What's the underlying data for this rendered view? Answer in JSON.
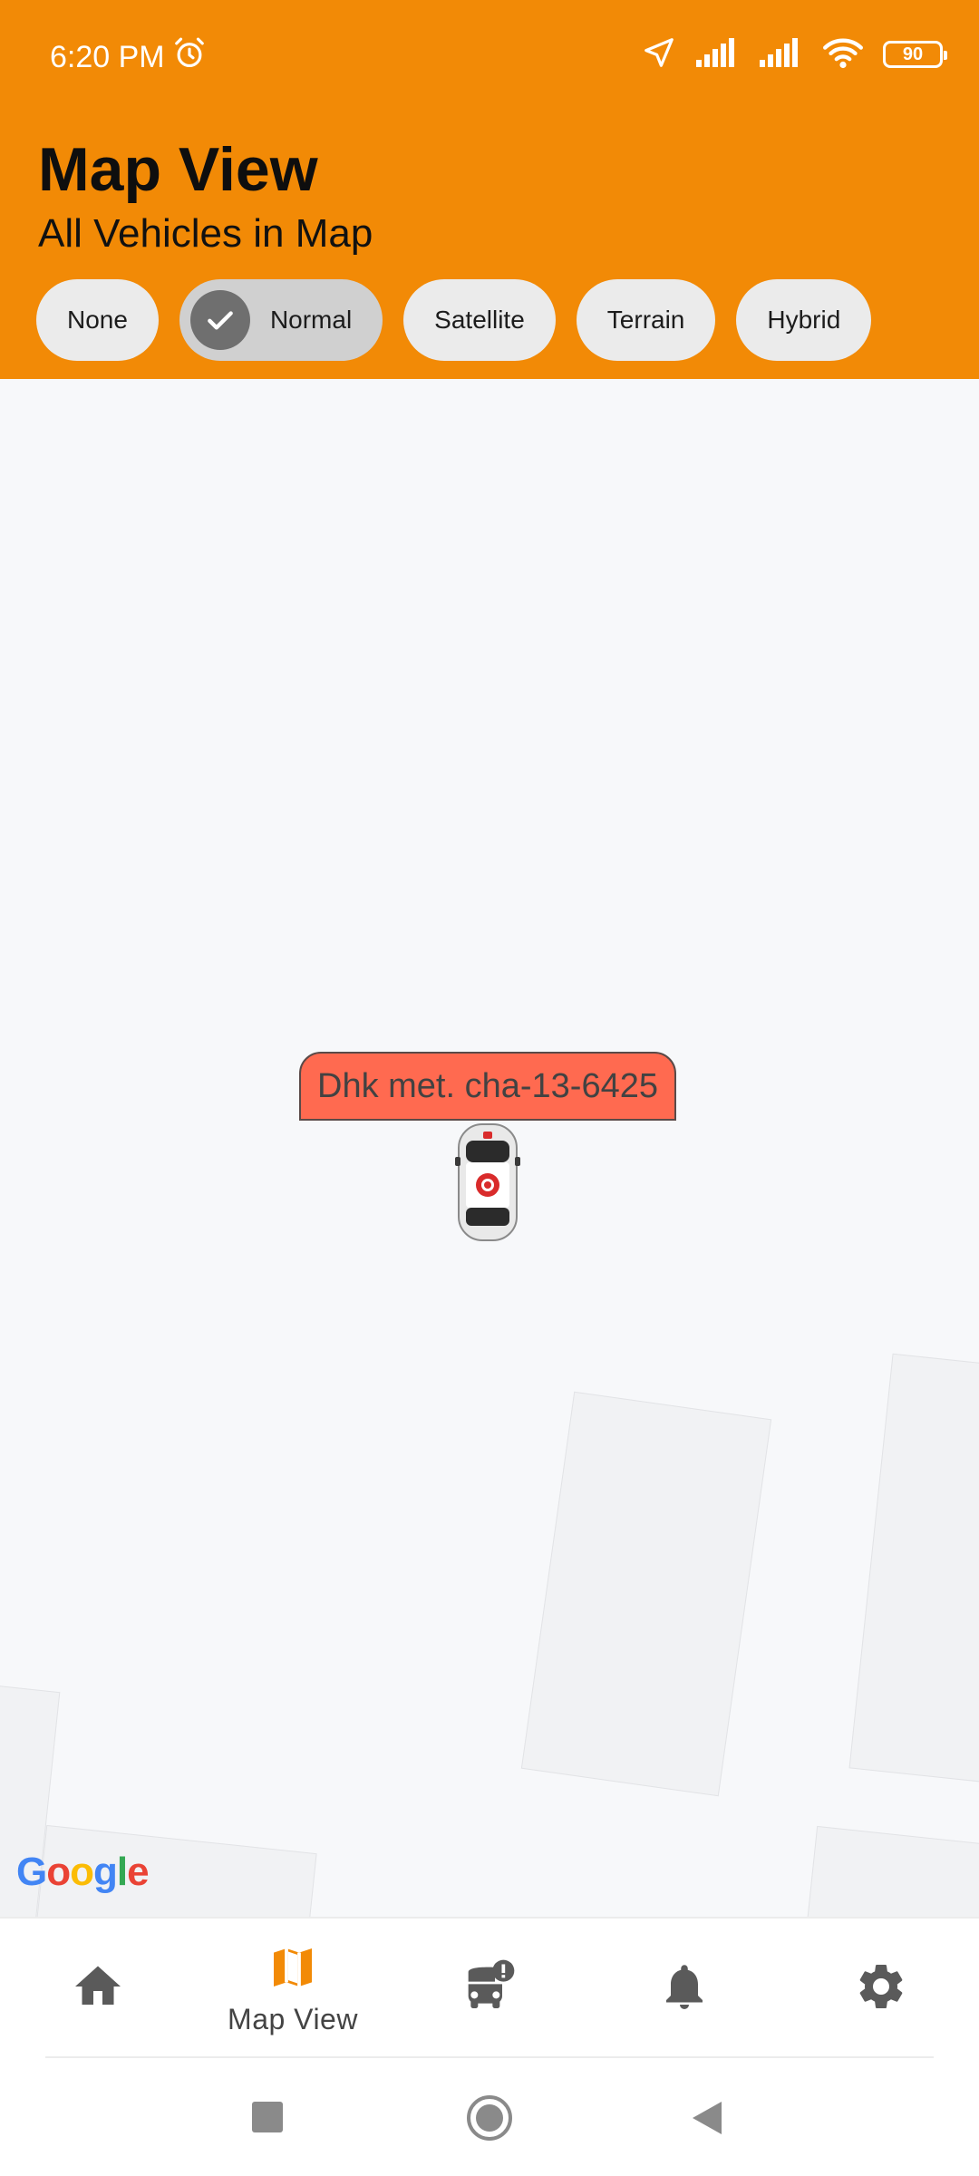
{
  "status_bar": {
    "time": "6:20 PM",
    "battery": "90",
    "icons": [
      "alarm-icon",
      "location-icon",
      "signal-icon",
      "signal-icon",
      "wifi-icon",
      "battery-icon"
    ]
  },
  "header": {
    "title": "Map View",
    "subtitle": "All Vehicles in Map",
    "background_color": "#f28a06"
  },
  "map_types": [
    {
      "label": "None",
      "selected": false
    },
    {
      "label": "Normal",
      "selected": true
    },
    {
      "label": "Satellite",
      "selected": false
    },
    {
      "label": "Terrain",
      "selected": false
    },
    {
      "label": "Hybrid",
      "selected": false
    }
  ],
  "map": {
    "vehicle_label": "Dhk met. cha-13-6425",
    "vehicle_label_color": "#ff6a50",
    "attribution": "Google"
  },
  "bottom_nav": {
    "items": [
      {
        "icon": "home-icon",
        "label": "",
        "active": false
      },
      {
        "icon": "map-icon",
        "label": "Map View",
        "active": true
      },
      {
        "icon": "bus-alert-icon",
        "label": "",
        "active": false
      },
      {
        "icon": "bell-icon",
        "label": "",
        "active": false
      },
      {
        "icon": "gear-icon",
        "label": "",
        "active": false
      }
    ],
    "active_color": "#f28a06"
  },
  "system_nav": [
    "recents-button",
    "home-button",
    "back-button"
  ]
}
